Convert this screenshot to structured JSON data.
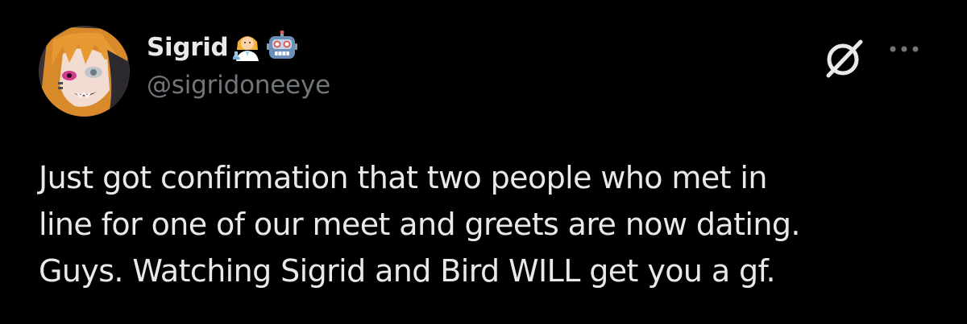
{
  "author": {
    "display_name": "Sigrid",
    "handle": "@sigridoneeye",
    "badges": [
      "woman-scientist-emoji",
      "robot-emoji"
    ],
    "avatar": "anime-character-avatar"
  },
  "toolbar": {
    "grok_icon": "grok-icon",
    "more_icon": "more-options-icon"
  },
  "post": {
    "lines": [
      "Just got confirmation that two people who met in",
      "line for one of our meet and greets are now dating.",
      "Guys. Watching Sigrid and Bird WILL get you a gf."
    ]
  },
  "colors": {
    "background": "#000000",
    "primary_text": "#e7e9ea",
    "secondary_text": "#71767b"
  }
}
